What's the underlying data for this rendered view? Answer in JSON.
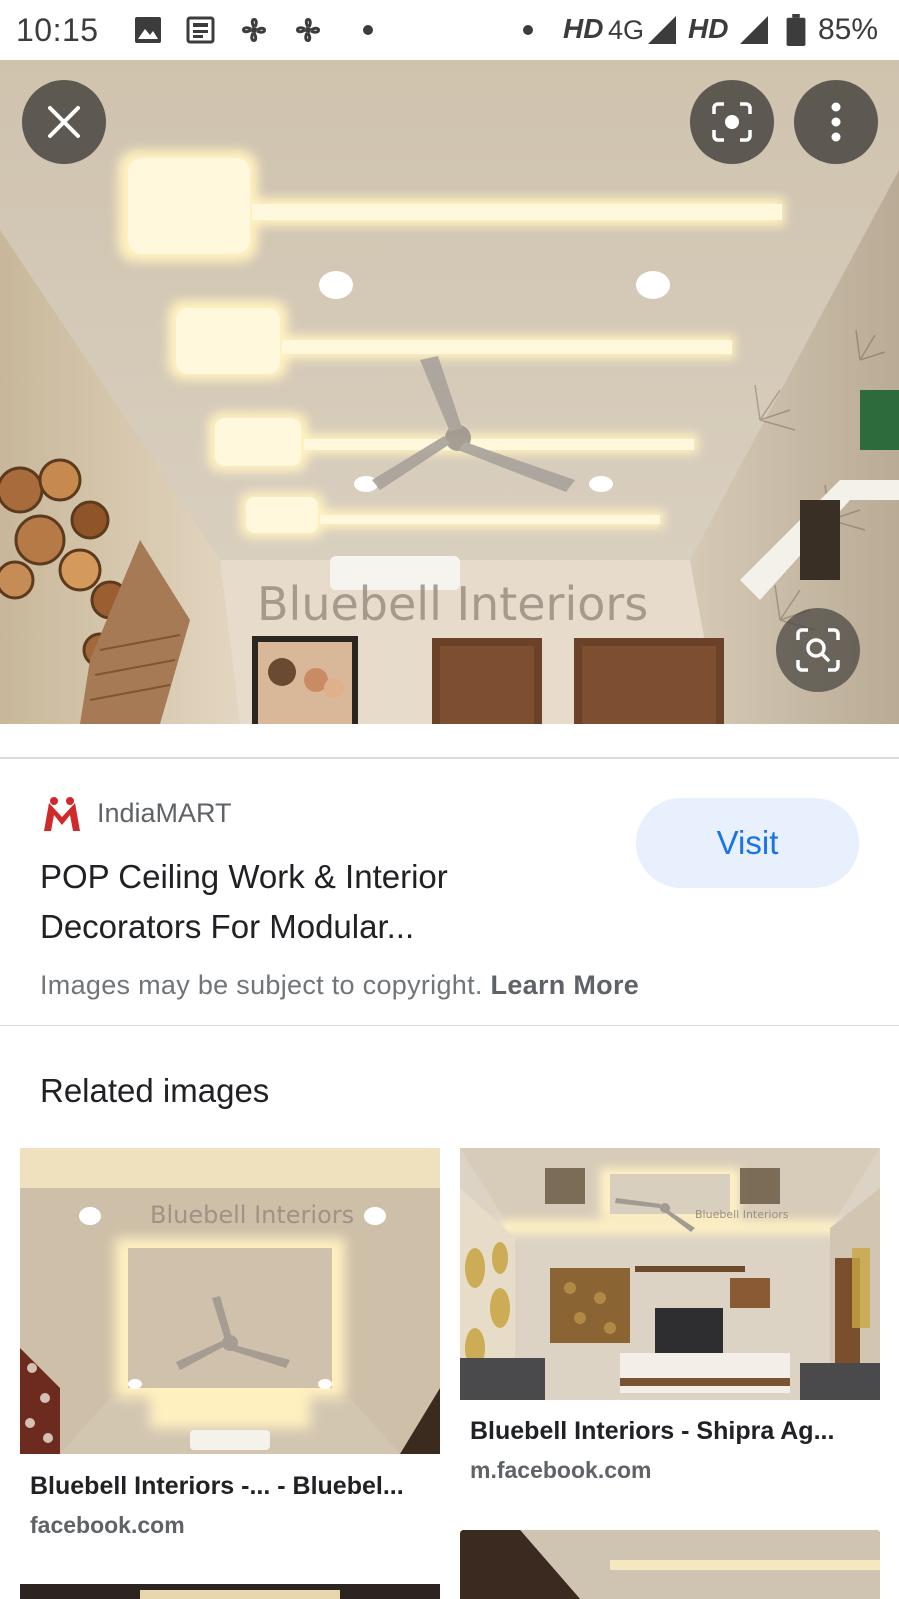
{
  "status_bar": {
    "time": "10:15",
    "network_hd_1": "HD",
    "network_4g": "4G",
    "network_hd_2": "HD",
    "battery": "85%",
    "icons": [
      "image-icon",
      "news-icon",
      "fan-icon",
      "fan-icon",
      "dot-icon",
      "dot-icon",
      "signal-icon",
      "signal-icon",
      "battery-icon"
    ]
  },
  "hero": {
    "watermark": "Bluebell Interiors",
    "buttons": [
      "close-icon",
      "lens-icon",
      "more-vert-icon",
      "search-region-icon"
    ]
  },
  "result": {
    "source": "IndiaMART",
    "title": "POP Ceiling Work & Interior Decorators For Modular...",
    "visit_label": "Visit",
    "copyright_text": "Images may be subject to copyright.",
    "learn_more": "Learn More"
  },
  "related": {
    "heading": "Related images",
    "items": [
      {
        "title": "Bluebell Interiors -... - Bluebel...",
        "domain": "facebook.com",
        "watermark": "Bluebell Interiors"
      },
      {
        "title": "Bluebell Interiors - Shipra Ag...",
        "domain": "m.facebook.com",
        "watermark": "Bluebell Interiors"
      }
    ]
  },
  "colors": {
    "accent": "#1a73e8",
    "visit_bg": "#e8f0fe",
    "ceiling": "#d8cdb8",
    "glow": "#fff3c8"
  }
}
